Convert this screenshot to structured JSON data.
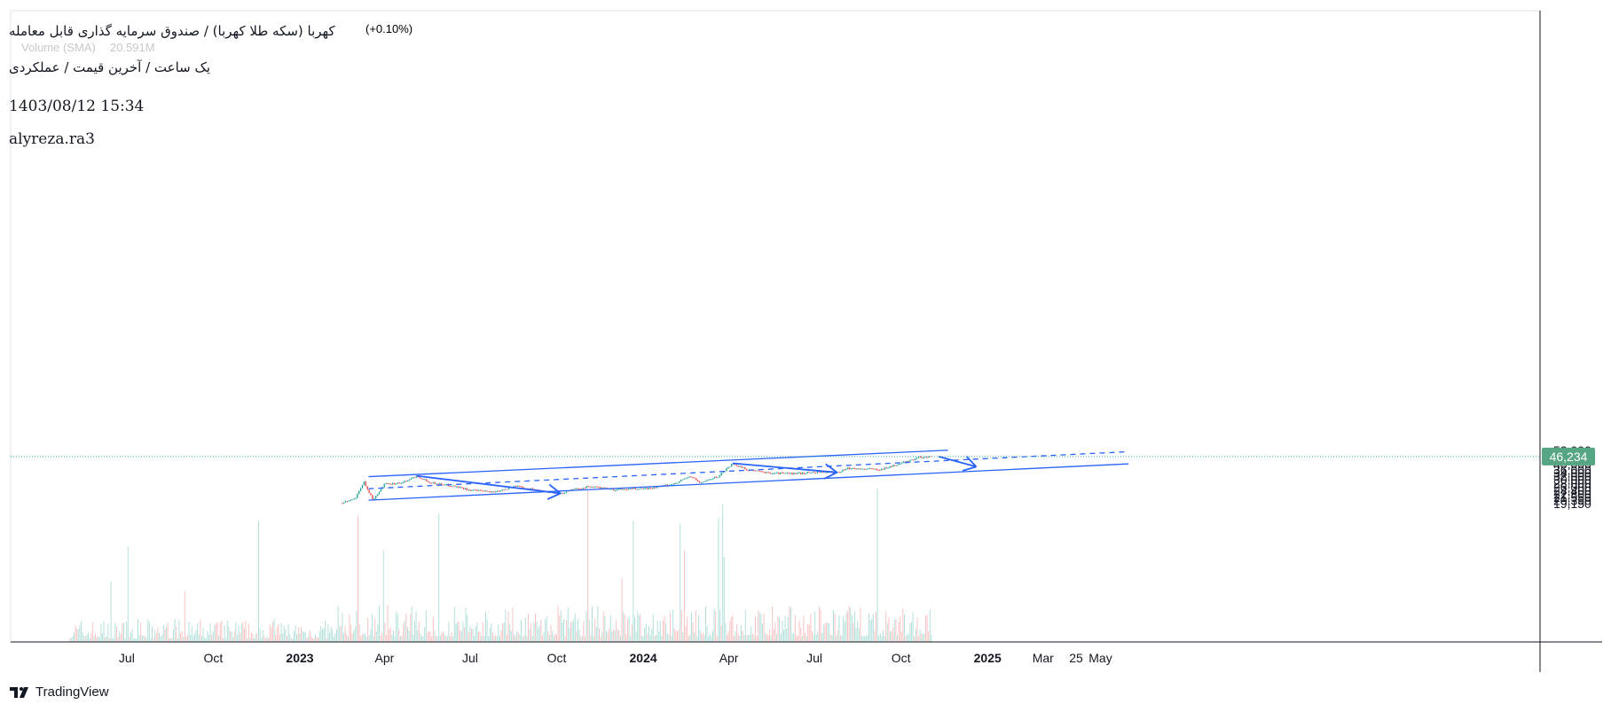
{
  "header": {
    "title": "کهربا (سکه طلا کهربا) / صندوق سرمایه گذاری قابل معامله",
    "subtitle": "یک ساعت / آخرین قیمت / عملکردی",
    "change_pct": "(+0.10%)",
    "volume_label": "Volume (SMA)",
    "volume_value": "20.591M",
    "timestamp": "1403/08/12 15:34",
    "author": "alyreza.ra3"
  },
  "branding": {
    "logo_text": "TradingView"
  },
  "colors": {
    "up": "#26a69a",
    "down": "#ef5350",
    "trend": "#2962ff",
    "price_badge": "#56a683",
    "grid": "#f0f3fa",
    "axis_text": "#131722"
  },
  "chart_data": {
    "type": "candlestick",
    "y_scale": "log",
    "y_axis_ticks": [
      "52,000",
      "48,000",
      "44,000",
      "40,000",
      "36,000",
      "34,000",
      "32,000",
      "30,000",
      "28,000",
      "26,000",
      "24,400",
      "22,800",
      "21,550",
      "20,350",
      "19,150"
    ],
    "x_axis_ticks": [
      {
        "label": "Jul",
        "bold": false
      },
      {
        "label": "Oct",
        "bold": false
      },
      {
        "label": "2023",
        "bold": true
      },
      {
        "label": "Apr",
        "bold": false
      },
      {
        "label": "Jul",
        "bold": false
      },
      {
        "label": "Oct",
        "bold": false
      },
      {
        "label": "2024",
        "bold": true
      },
      {
        "label": "Apr",
        "bold": false
      },
      {
        "label": "Jul",
        "bold": false
      },
      {
        "label": "Oct",
        "bold": false
      },
      {
        "label": "25",
        "bold": false
      },
      {
        "label": "2025",
        "bold": true
      },
      {
        "label": "Mar",
        "bold": false
      },
      {
        "label": "May",
        "bold": false
      }
    ],
    "last_price": 46234,
    "last_price_label": "46,234",
    "price_path": [
      [
        "2023-02-15",
        19300
      ],
      [
        "2023-03-01",
        21000
      ],
      [
        "2023-03-10",
        28700
      ],
      [
        "2023-03-20",
        20300
      ],
      [
        "2023-04-01",
        27500
      ],
      [
        "2023-04-20",
        28300
      ],
      [
        "2023-05-05",
        32200
      ],
      [
        "2023-05-20",
        28400
      ],
      [
        "2023-06-15",
        26500
      ],
      [
        "2023-07-01",
        24600
      ],
      [
        "2023-07-25",
        23800
      ],
      [
        "2023-08-20",
        26600
      ],
      [
        "2023-09-10",
        24700
      ],
      [
        "2023-10-05",
        23000
      ],
      [
        "2023-10-15",
        24600
      ],
      [
        "2023-11-05",
        26400
      ],
      [
        "2023-12-01",
        24800
      ],
      [
        "2024-01-10",
        25500
      ],
      [
        "2024-02-01",
        27500
      ],
      [
        "2024-02-20",
        32000
      ],
      [
        "2024-03-01",
        28300
      ],
      [
        "2024-03-20",
        31600
      ],
      [
        "2024-04-05",
        40600
      ],
      [
        "2024-04-20",
        36200
      ],
      [
        "2024-05-10",
        34200
      ],
      [
        "2024-06-10",
        33500
      ],
      [
        "2024-07-05",
        34700
      ],
      [
        "2024-07-25",
        34200
      ],
      [
        "2024-08-05",
        37000
      ],
      [
        "2024-09-10",
        36400
      ],
      [
        "2024-10-01",
        40600
      ],
      [
        "2024-10-20",
        45600
      ],
      [
        "2024-11-02",
        46234
      ]
    ],
    "channel": {
      "upper": [
        [
          "2023-03-15",
          31700
        ],
        [
          "2024-11-20",
          52000
        ]
      ],
      "middle": [
        [
          "2023-03-15",
          25300
        ],
        [
          "2025-05-31",
          50600
        ]
      ],
      "lower": [
        [
          "2023-03-15",
          20400
        ],
        [
          "2025-05-31",
          40300
        ]
      ]
    },
    "arrows": [
      {
        "from": [
          "2023-05-05",
          32200
        ],
        "to": [
          "2023-10-05",
          23200
        ]
      },
      {
        "from": [
          "2024-04-05",
          40700
        ],
        "to": [
          "2024-07-25",
          34300
        ]
      },
      {
        "from": [
          "2024-11-10",
          46200
        ],
        "to": [
          "2024-12-20",
          38200
        ]
      }
    ]
  }
}
